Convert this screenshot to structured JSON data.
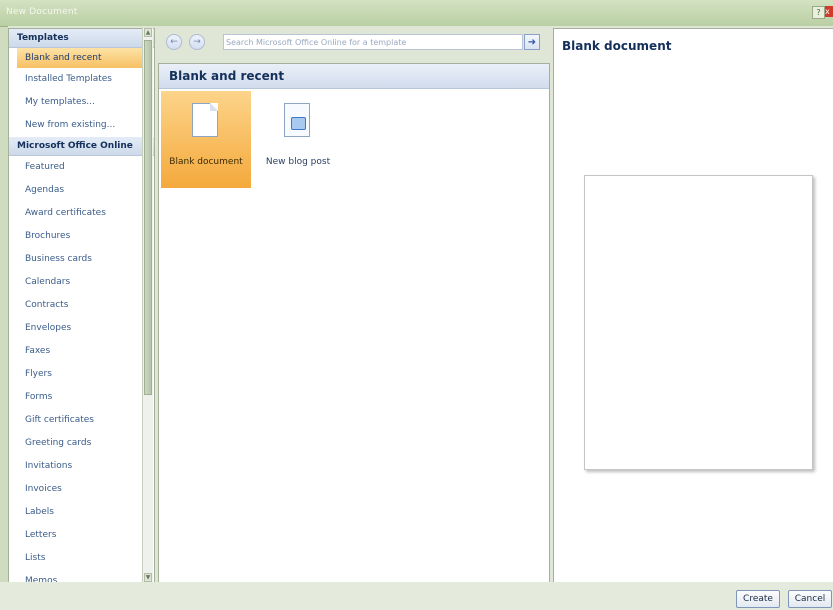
{
  "window": {
    "title": "New Document",
    "help_glyph": "?",
    "close_glyph": "x"
  },
  "sidebar": {
    "section_templates": "Templates",
    "local_items": [
      {
        "label": "Blank and recent",
        "selected": true
      },
      {
        "label": "Installed Templates"
      },
      {
        "label": "My templates..."
      },
      {
        "label": "New from existing..."
      }
    ],
    "section_online": "Microsoft Office Online",
    "online_items": [
      "Featured",
      "Agendas",
      "Award certificates",
      "Brochures",
      "Business cards",
      "Calendars",
      "Contracts",
      "Envelopes",
      "Faxes",
      "Flyers",
      "Forms",
      "Gift certificates",
      "Greeting cards",
      "Invitations",
      "Invoices",
      "Labels",
      "Letters",
      "Lists",
      "Memos"
    ]
  },
  "toolbar": {
    "back_icon": "arrow-left-icon",
    "forward_icon": "arrow-right-icon",
    "search_placeholder": "Search Microsoft Office Online for a template",
    "go_icon": "arrow-right-icon"
  },
  "main": {
    "heading": "Blank and recent",
    "tiles": [
      {
        "label": "Blank document",
        "icon": "blank-document-icon",
        "selected": true
      },
      {
        "label": "New blog post",
        "icon": "blog-post-icon",
        "selected": false
      }
    ]
  },
  "preview": {
    "title": "Blank document"
  },
  "buttons": {
    "create": "Create",
    "cancel": "Cancel"
  },
  "colors": {
    "selection_accent": "#f7c063",
    "heading_text": "#15305b",
    "frame": "#cfdcc0"
  }
}
